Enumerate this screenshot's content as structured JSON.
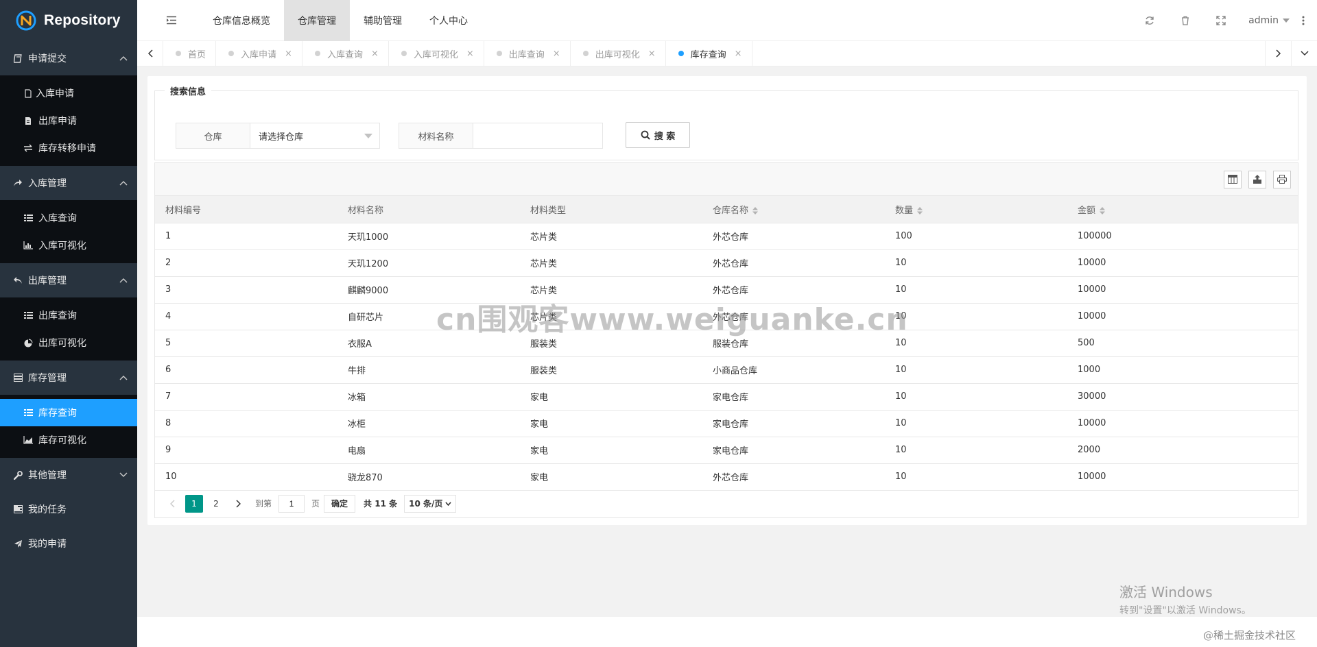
{
  "app": {
    "title": "Repository"
  },
  "sidebar": {
    "groups": [
      {
        "label": "申请提交",
        "items": [
          {
            "label": "入库申请"
          },
          {
            "label": "出库申请"
          },
          {
            "label": "库存转移申请"
          }
        ]
      },
      {
        "label": "入库管理",
        "items": [
          {
            "label": "入库查询"
          },
          {
            "label": "入库可视化"
          }
        ]
      },
      {
        "label": "出库管理",
        "items": [
          {
            "label": "出库查询"
          },
          {
            "label": "出库可视化"
          }
        ]
      },
      {
        "label": "库存管理",
        "items": [
          {
            "label": "库存查询"
          },
          {
            "label": "库存可视化"
          }
        ]
      }
    ],
    "other": "其他管理",
    "tasks": "我的任务",
    "applications": "我的申请"
  },
  "header": {
    "nav": [
      "仓库信息概览",
      "仓库管理",
      "辅助管理",
      "个人中心"
    ],
    "user": "admin"
  },
  "tabs": [
    "首页",
    "入库申请",
    "入库查询",
    "入库可视化",
    "出库查询",
    "出库可视化",
    "库存查询"
  ],
  "search": {
    "legend": "搜索信息",
    "warehouse_label": "仓库",
    "warehouse_value": "请选择仓库",
    "material_label": "材料名称",
    "material_value": "",
    "button": "搜 索"
  },
  "table": {
    "columns": [
      "材料编号",
      "材料名称",
      "材料类型",
      "仓库名称",
      "数量",
      "金额"
    ],
    "rows": [
      [
        "1",
        "天玑1000",
        "芯片类",
        "外芯仓库",
        "100",
        "100000"
      ],
      [
        "2",
        "天玑1200",
        "芯片类",
        "外芯仓库",
        "10",
        "10000"
      ],
      [
        "3",
        "麒麟9000",
        "芯片类",
        "外芯仓库",
        "10",
        "10000"
      ],
      [
        "4",
        "自研芯片",
        "芯片类",
        "外芯仓库",
        "10",
        "10000"
      ],
      [
        "5",
        "衣服A",
        "服装类",
        "服装仓库",
        "10",
        "500"
      ],
      [
        "6",
        "牛排",
        "服装类",
        "小商品仓库",
        "10",
        "1000"
      ],
      [
        "7",
        "冰箱",
        "家电",
        "家电仓库",
        "10",
        "30000"
      ],
      [
        "8",
        "冰柜",
        "家电",
        "家电仓库",
        "10",
        "10000"
      ],
      [
        "9",
        "电扇",
        "家电",
        "家电仓库",
        "10",
        "2000"
      ],
      [
        "10",
        "骁龙870",
        "家电",
        "外芯仓库",
        "10",
        "10000"
      ]
    ]
  },
  "pager": {
    "current": "1",
    "next_page": "2",
    "goto_prefix": "到第",
    "goto_value": "1",
    "goto_suffix": "页",
    "confirm": "确定",
    "total": "共 11 条",
    "limit": "10 条/页"
  },
  "windows_activation": {
    "line1": "激活 Windows",
    "line2": "转到\"设置\"以激活 Windows。"
  },
  "credit": "@稀土掘金技术社区",
  "watermark": "cn围观客www.weiguanke.cn"
}
